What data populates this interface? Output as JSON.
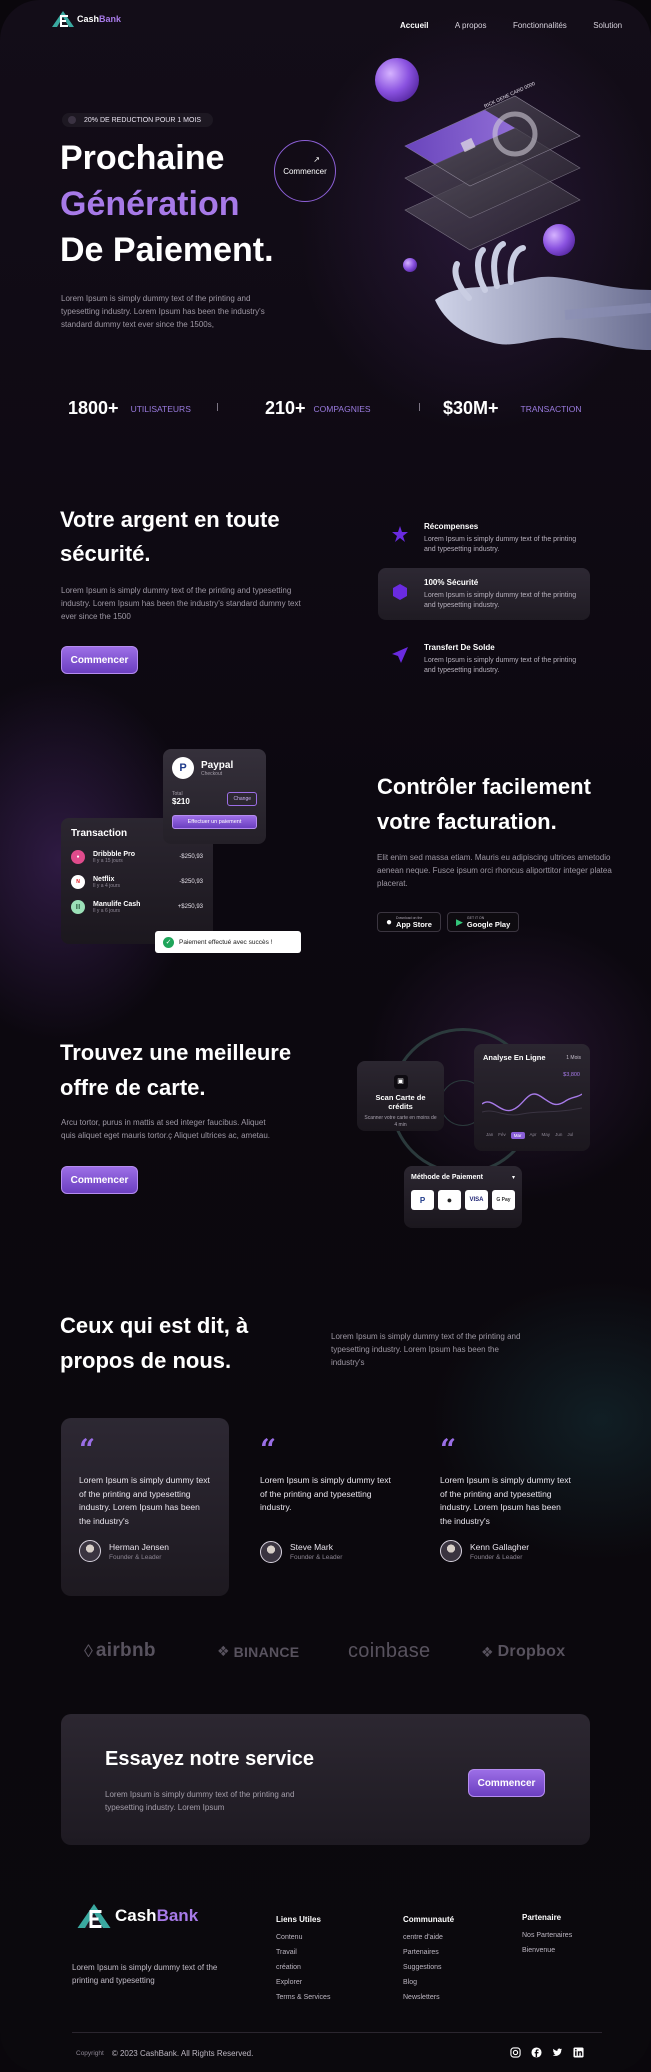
{
  "brand": {
    "name_a": "Cash",
    "name_b": "Bank"
  },
  "nav": {
    "items": [
      "Accueil",
      "A propos",
      "Fonctionnalités",
      "Solution"
    ]
  },
  "hero": {
    "badge": "20% DE REDUCTION POUR 1 MOIS",
    "line1": "Prochaine",
    "line2": "Génération",
    "line3": "De Paiement.",
    "text": "Lorem Ipsum is simply dummy text of the printing and typesetting industry. Lorem Ipsum has been the industry's standard dummy text ever since the 1500s,",
    "cta": "Commencer",
    "card_text": "RICK GENE CARD 0000"
  },
  "stats": [
    {
      "num": "1800+",
      "label": "UTILISATEURS"
    },
    {
      "num": "210+",
      "label": "COMPAGNIES"
    },
    {
      "num": "$30M+",
      "label": "TRANSACTION"
    }
  ],
  "security": {
    "title1": "Votre argent en toute",
    "title2": "sécurité.",
    "text": "Lorem Ipsum is simply dummy text of the printing and typesetting industry. Lorem Ipsum has been the industry's standard dummy text ever since the 1500",
    "cta": "Commencer",
    "features": [
      {
        "title": "Récompenses",
        "text": "Lorem Ipsum is simply dummy text of the printing and typesetting industry."
      },
      {
        "title": "100% Sécurité",
        "text": "Lorem Ipsum is simply dummy text of the printing and typesetting industry."
      },
      {
        "title": "Transfert De Solde",
        "text": "Lorem Ipsum is simply dummy text of the printing and typesetting industry."
      }
    ]
  },
  "billing": {
    "title1": "Contrôler facilement",
    "title2": "votre facturation.",
    "text": "Elit enim sed massa etiam. Mauris eu adipiscing ultrices ametodio aenean neque. Fusce ipsum orci rhoncus aliporttitor integer platea placerat.",
    "appstore_small": "Download on the",
    "appstore": "App Store",
    "play_small": "GET IT ON",
    "play": "Google Play",
    "transaction_title": "Transaction",
    "transactions": [
      {
        "name": "Dribbble Pro",
        "time": "Il y a 15 jours",
        "amount": "-$250,93"
      },
      {
        "name": "Netflix",
        "time": "Il y a 4 jours",
        "amount": "-$250,93"
      },
      {
        "name": "Manulife Cash",
        "time": "Il y a 6 jours",
        "amount": "+$250,93"
      }
    ],
    "paypal_title": "Paypal",
    "paypal_sub": "Checkout",
    "paypal_total_lbl": "Total",
    "paypal_total": "$210",
    "paypal_change": "Change",
    "paypal_btn": "Effectuer un paiement",
    "toast": "Paiement effectué avec succès !"
  },
  "card_offer": {
    "title1": "Trouvez une meilleure",
    "title2": "offre de carte.",
    "text": "Arcu tortor, purus in mattis at sed integer faucibus. Aliquet quis aliquet eget mauris tortor.ç Aliquet ultrices ac, ametau.",
    "cta": "Commencer",
    "scan_title": "Scan Carte de crédits",
    "scan_text": "Scanner votre carte en moins de 4 min",
    "analyse_title": "Analyse En Ligne",
    "analyse_period": "1 Mois",
    "analyse_value": "$3,800",
    "months": [
      "Jan",
      "Fév",
      "Mar",
      "Apr",
      "May",
      "Jun",
      "Jul"
    ],
    "method_title": "Méthode de Paiement",
    "methods": [
      "P",
      "",
      "VISA",
      "G Pay"
    ]
  },
  "testimonials": {
    "title1": "Ceux qui est dit, à",
    "title2": "propos de nous.",
    "text": "Lorem Ipsum is simply dummy text of the printing and typesetting industry. Lorem Ipsum has been the industry's",
    "items": [
      {
        "quote": "Lorem Ipsum is simply dummy text of the printing and typesetting industry. Lorem Ipsum has been the industry's",
        "name": "Herman Jensen",
        "role": "Founder & Leader"
      },
      {
        "quote": "Lorem Ipsum is simply dummy text of the printing and typesetting industry.",
        "name": "Steve Mark",
        "role": "Founder & Leader"
      },
      {
        "quote": "Lorem Ipsum is simply dummy text of the printing and typesetting industry. Lorem Ipsum has been the industry's",
        "name": "Kenn Gallagher",
        "role": "Founder & Leader"
      }
    ]
  },
  "partners": [
    "airbnb",
    "BINANCE",
    "coinbase",
    "Dropbox"
  ],
  "cta_band": {
    "title": "Essayez notre service",
    "text": "Lorem Ipsum is simply dummy text of the printing and typesetting industry. Lorem Ipsum",
    "button": "Commencer"
  },
  "footer": {
    "text": "Lorem Ipsum is simply dummy text of the printing and typesetting",
    "cols": [
      {
        "title": "Liens Utiles",
        "links": [
          "Contenu",
          "Travail",
          "création",
          "Explorer",
          "Terms & Services"
        ]
      },
      {
        "title": "Communauté",
        "links": [
          "centre d'aide",
          "Partenaires",
          "Suggestions",
          "Blog",
          "Newsletters"
        ]
      },
      {
        "title": "Partenaire",
        "links": [
          "Nos Partenaires",
          "Bienvenue"
        ]
      }
    ],
    "copyright_lbl": "Copyright",
    "copyright": "© 2023 CashBank. All Rights Reserved."
  },
  "colors": {
    "accent": "#9c6ee6",
    "background": "#0b080d"
  }
}
